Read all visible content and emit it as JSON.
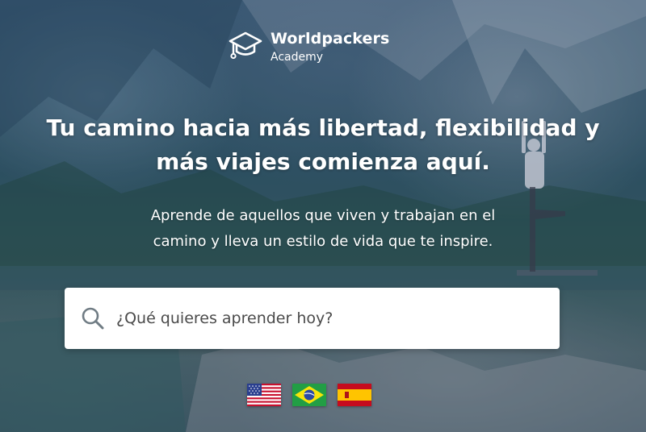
{
  "brand": {
    "name": "Worldpackers",
    "subtitle": "Academy",
    "icon": "graduation-cap-icon"
  },
  "hero": {
    "headline_line1": "Tu camino hacia más libertad, flexibilidad y",
    "headline_line2": "más viajes comienza aquí.",
    "subtitle_line1": "Aprende de aquellos que viven y trabajan en el",
    "subtitle_line2": "camino y lleva un estilo de vida que te inspire."
  },
  "search": {
    "placeholder": "¿Qué quieres aprender hoy?",
    "value": "",
    "icon": "search-icon"
  },
  "languages": [
    {
      "icon": "us-flag-icon"
    },
    {
      "icon": "brazil-flag-icon"
    },
    {
      "icon": "spain-flag-icon"
    }
  ],
  "colors": {
    "text": "#ffffff",
    "search_bg": "#ffffff",
    "icon_gray": "#707c84"
  }
}
